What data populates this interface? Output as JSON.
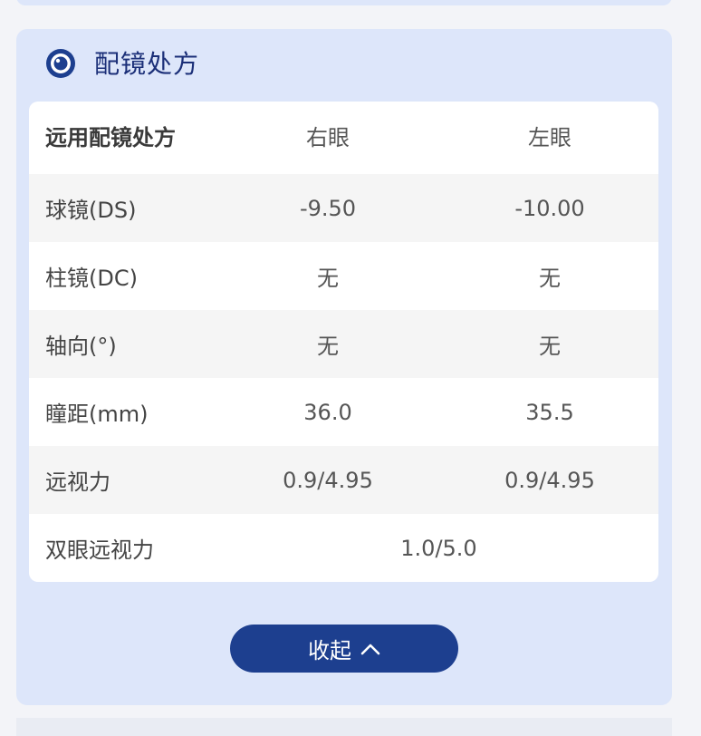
{
  "section": {
    "title": "配镜处方",
    "icon": "eye-icon"
  },
  "table": {
    "headers": [
      "远用配镜处方",
      "右眼",
      "左眼"
    ],
    "rows": [
      {
        "label": "球镜(DS)",
        "right": "-9.50",
        "left": "-10.00"
      },
      {
        "label": "柱镜(DC)",
        "right": "无",
        "left": "无"
      },
      {
        "label": "轴向(°)",
        "right": "无",
        "left": "无"
      },
      {
        "label": "瞳距(mm)",
        "right": "36.0",
        "left": "35.5"
      },
      {
        "label": "远视力",
        "right": "0.9/4.95",
        "left": "0.9/4.95"
      }
    ],
    "binocular": {
      "label": "双眼远视力",
      "value": "1.0/5.0"
    }
  },
  "collapse_button": {
    "label": "收起",
    "icon": "chevron-up-icon"
  },
  "colors": {
    "accent": "#1d3f8f",
    "panel": "#dde6fa",
    "title": "#1b2f78"
  }
}
